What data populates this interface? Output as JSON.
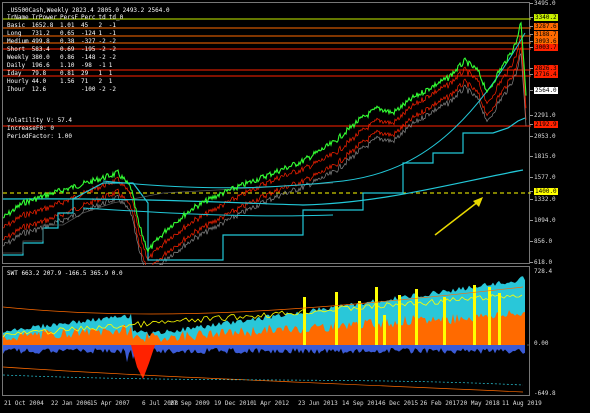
{
  "window": {
    "title": ".US500Cash,Weekly  2823.4 2805.0 2493.2 2564.0"
  },
  "stats_table": {
    "headers": [
      "TrName",
      "TrPower",
      "PersF",
      "Perc",
      "td",
      "td_0"
    ],
    "rows": [
      [
        "Basic",
        "1652.8",
        "1.01",
        "45",
        "2",
        "-1"
      ],
      [
        "Long",
        "731.2",
        "0.65",
        "-124",
        "1",
        "-1"
      ],
      [
        "Medium",
        "499.8",
        "0.38",
        "-327",
        "-2",
        "-2"
      ],
      [
        "Short",
        "583.4",
        "0.69",
        "-195",
        "-2",
        "-2"
      ],
      [
        "Weekly",
        "380.0",
        "0.86",
        "-148",
        "-2",
        "-2"
      ],
      [
        "Daily",
        "196.6",
        "1.10",
        "-98",
        "-1",
        "1"
      ],
      [
        "Iday",
        "79.8",
        "0.81",
        "29",
        "1",
        "1"
      ],
      [
        "Hourly",
        "44.0",
        "1.56",
        "71",
        "2",
        "1"
      ],
      [
        "Ihour",
        "12.6",
        "",
        "-100",
        "-2",
        "-2"
      ]
    ]
  },
  "indicators": {
    "volatility": "Volatility V: 57.4",
    "increase": "IncreaseF0: 0",
    "period": "PeriodFactor: 1.00"
  },
  "price_axis": {
    "labels": [
      "3495.0",
      "3340.2",
      "3287.6",
      "3188.7",
      "3093.6",
      "3003.7",
      "2826.3",
      "2716.4",
      "2564.0",
      "2291.0",
      "2192.9",
      "2053.0",
      "1815.0",
      "1577.0",
      "1400.0",
      "1332.0",
      "1094.0",
      "856.0",
      "618.0"
    ],
    "box_colors": {
      "3340.2": "#c8f000",
      "3287.6": "#ff6a00",
      "3188.7": "#ff6a00",
      "3093.6": "#ff6a00",
      "3003.7": "#ff2200",
      "2826.3": "#ff2200",
      "2716.4": "#ff2200",
      "2564.0": "#ffffff",
      "2192.9": "#ff2200",
      "1400.0": "#ffff00"
    }
  },
  "time_axis": {
    "labels": [
      "21 Oct 2004",
      "22 Jan 2006",
      "15 Apr 2007",
      "6 Jul 2008",
      "27 Sep 2009",
      "19 Dec 2010",
      "1 Apr 2012",
      "23 Jun 2013",
      "14 Sep 2014",
      "6 Dec 2015",
      "26 Feb 2017",
      "20 May 2018",
      "11 Aug 2019"
    ]
  },
  "oscillator": {
    "title": "SWT 663.2 207.9 -166.5 365.9 0.0",
    "axis_labels": [
      "728.4",
      "0.00",
      "-649.8"
    ]
  },
  "colors": {
    "price": "#33ff33",
    "cyan": "#22c8d8",
    "orange": "#ff6a00",
    "red": "#ff2200",
    "yellow": "#ffff00",
    "lime": "#c8f000",
    "arrow": "#e8d800"
  }
}
